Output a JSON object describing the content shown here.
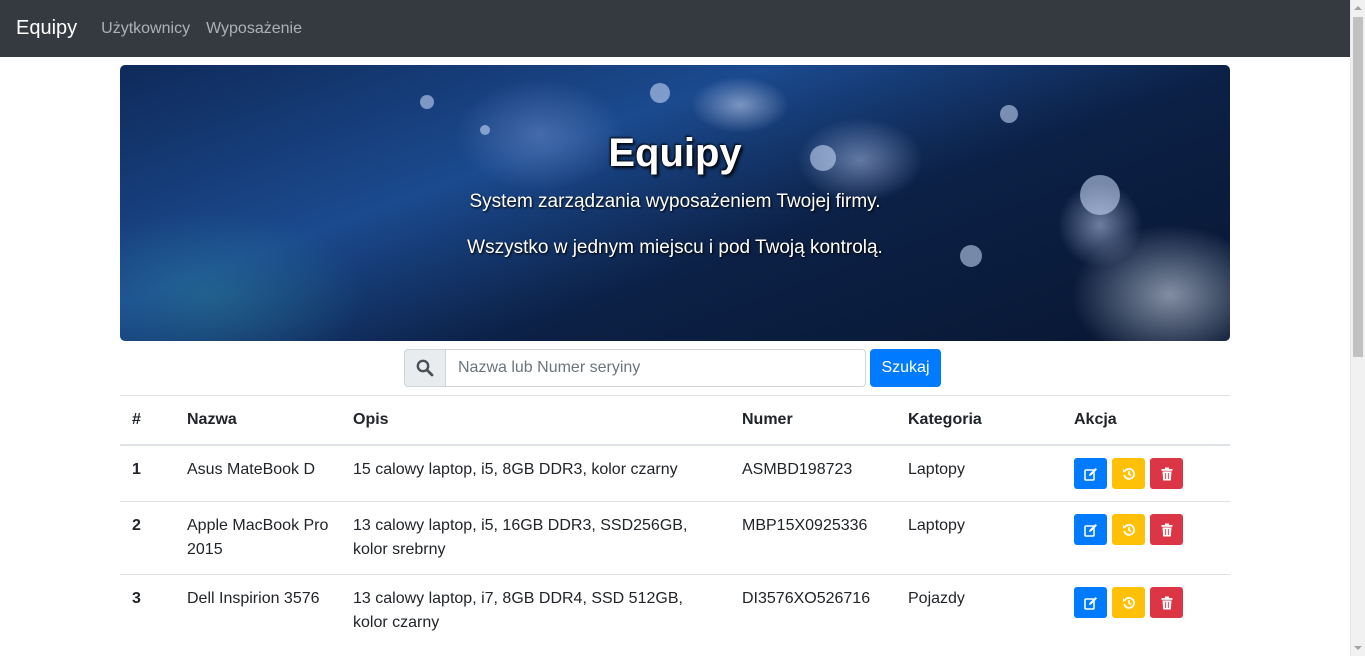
{
  "navbar": {
    "brand": "Equipy",
    "links": [
      "Użytkownicy",
      "Wyposażenie"
    ]
  },
  "hero": {
    "title": "Equipy",
    "line1": "System zarządzania wyposażeniem Twojej firmy.",
    "line2": "Wszystko w jednym miejscu i pod Twoją kontrolą."
  },
  "search": {
    "icon": "search-icon",
    "placeholder": "Nazwa lub Numer seryiny",
    "button_label": "Szukaj"
  },
  "table": {
    "headers": [
      "#",
      "Nazwa",
      "Opis",
      "Numer",
      "Kategoria",
      "Akcja"
    ],
    "rows": [
      {
        "num": "1",
        "name": "Asus MateBook D",
        "desc": "15 calowy laptop, i5, 8GB DDR3, kolor czarny",
        "serial": "ASMBD198723",
        "category": "Laptopy"
      },
      {
        "num": "2",
        "name": "Apple MacBook Pro 2015",
        "desc": "13 calowy laptop, i5, 16GB DDR3, SSD256GB, kolor srebrny",
        "serial": "MBP15X0925336",
        "category": "Laptopy"
      },
      {
        "num": "3",
        "name": "Dell Inspirion 3576",
        "desc": "13 calowy laptop, i7, 8GB DDR4, SSD 512GB, kolor czarny",
        "serial": "DI3576XO526716",
        "category": "Pojazdy"
      }
    ],
    "action_icons": [
      "edit-icon",
      "history-icon",
      "trash-icon"
    ]
  },
  "colors": {
    "navbar": "#343a40",
    "primary": "#007bff",
    "warning": "#ffc107",
    "danger": "#dc3545"
  }
}
